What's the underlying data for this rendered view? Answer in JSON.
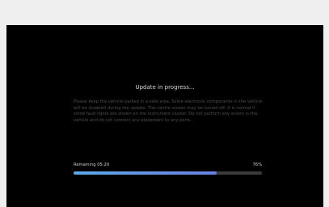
{
  "update": {
    "title": "Update in progress...",
    "message": "Please keep the vehicle parked in a safe area. Some electronic components in the vehicle will be disabled during the update. The centre screen may be turned off. It is normal if some fault lights are shown on the instrument cluster. Do not perform any action in the vehicle and do not connect any equipment to any ports.",
    "remaining_label": "Remaining 05:20",
    "percent_label": "76%",
    "progress_fraction": 0.76
  },
  "colors": {
    "progress_start": "#5aa9e6",
    "progress_end": "#6a7fe0"
  }
}
